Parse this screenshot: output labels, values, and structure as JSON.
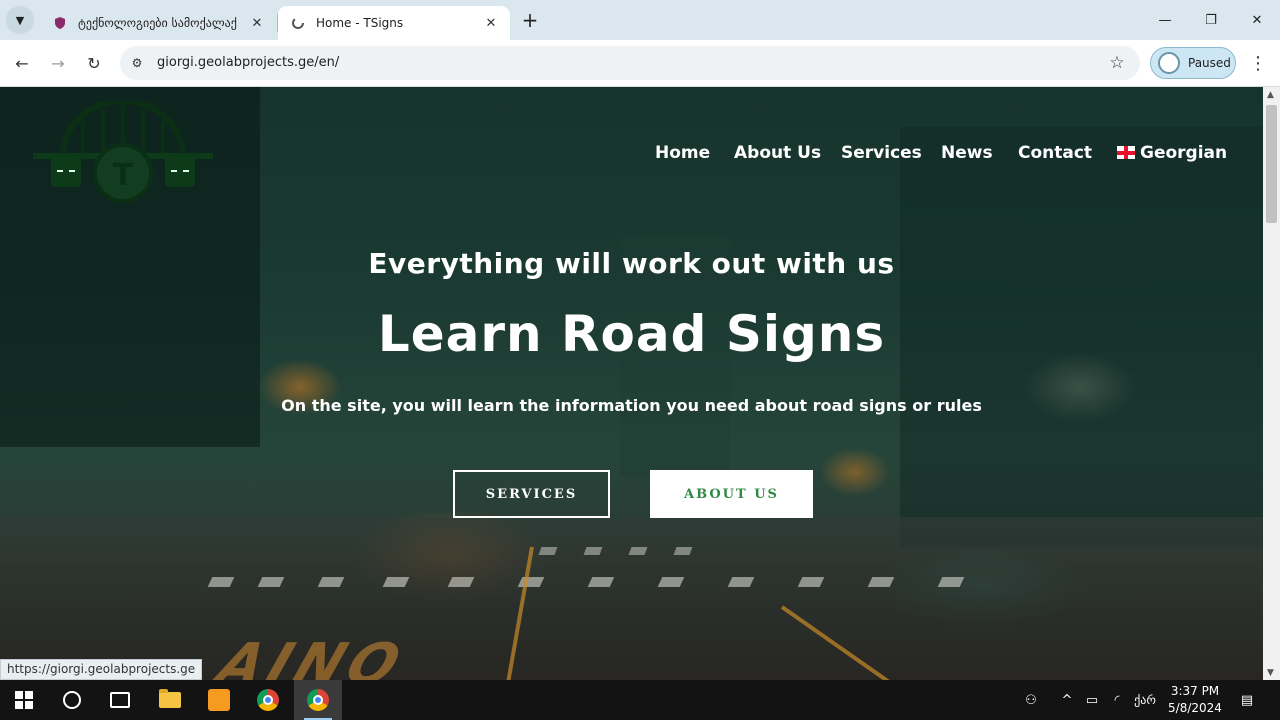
{
  "browser": {
    "tabs": [
      {
        "title": "ტექნოლოგიები სამოქალაქ",
        "active": false
      },
      {
        "title": "Home - TSigns",
        "active": true
      }
    ],
    "url": "giorgi.geolabprojects.ge/en/",
    "profile_label": "Paused",
    "status_url": "https://giorgi.geolabprojects.ge"
  },
  "site": {
    "logo_letter": "T",
    "nav": {
      "home": "Home",
      "about": "About Us",
      "services": "Services",
      "news": "News",
      "contact": "Contact",
      "language": "Georgian"
    },
    "hero": {
      "subtitle": "Everything will work out with us",
      "title": "Learn Road Signs",
      "description": "On the site, you will learn the information you need about road signs or rules",
      "btn_services": "SERVICES",
      "btn_about": "ABOUT US"
    },
    "road_marking": "AJNO"
  },
  "taskbar": {
    "time": "3:37 PM",
    "date": "5/8/2024",
    "lang": "ქარ"
  },
  "colors": {
    "accent_green": "#2f8a45",
    "logo_green": "#0d3b1a"
  }
}
